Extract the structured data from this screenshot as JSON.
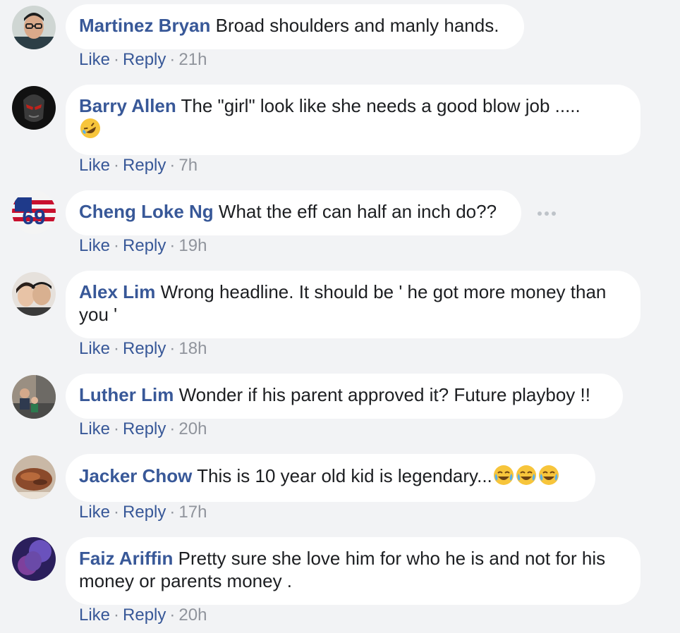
{
  "actions": {
    "like": "Like",
    "reply": "Reply",
    "dot": "·"
  },
  "comments": [
    {
      "author": "Martinez Bryan",
      "text": "Broad shoulders and manly hands.",
      "time": "21h",
      "avatar": "avatar-photo"
    },
    {
      "author": "Barry Allen",
      "text": "The \"girl\" look like she needs a good blow job .....",
      "emojis": [
        "rolling-on-floor-laughing-emoji"
      ],
      "time": "7h",
      "avatar": "avatar-photo"
    },
    {
      "author": "Cheng Loke Ng",
      "text": "What the eff can half an inch do??",
      "time": "19h",
      "avatar": "avatar-photo",
      "more_icon": "more-options-icon"
    },
    {
      "author": "Alex Lim",
      "text": "Wrong headline. It should be ' he got more money than you '",
      "time": "18h",
      "avatar": "avatar-photo"
    },
    {
      "author": "Luther Lim",
      "text": "Wonder if his parent approved it? Future playboy !!",
      "time": "20h",
      "avatar": "avatar-photo"
    },
    {
      "author": "Jacker Chow",
      "text": "This is 10 year old kid is legendary...",
      "emojis": [
        "tears-of-joy-emoji",
        "tears-of-joy-emoji",
        "tears-of-joy-emoji"
      ],
      "time": "17h",
      "avatar": "avatar-photo"
    },
    {
      "author": "Faiz Ariffin",
      "text": "Pretty sure she love him for who he is and not for his money or parents money .",
      "time": "20h",
      "avatar": "avatar-photo"
    }
  ],
  "colors": {
    "background": "#f2f3f5",
    "bubble": "#ffffff",
    "author": "#385898",
    "text": "#1c1e21",
    "meta": "#90949c",
    "emoji_face": "#f7c53b"
  }
}
